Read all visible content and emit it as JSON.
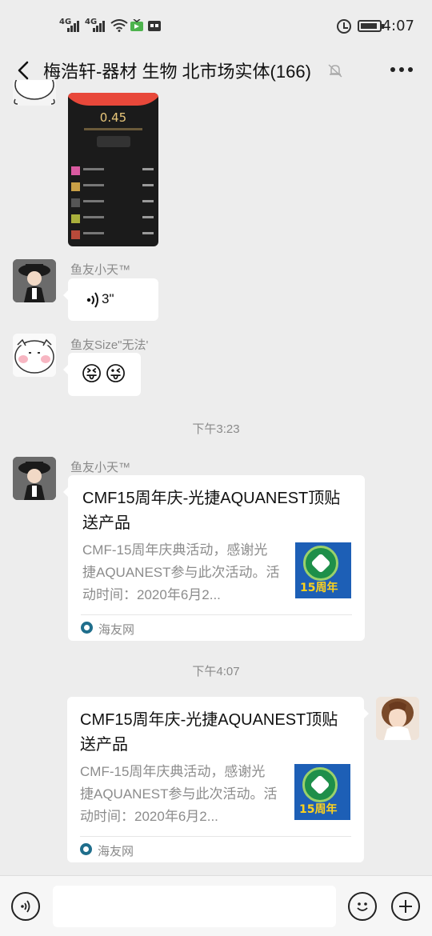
{
  "status_bar": {
    "network_1": "4G",
    "network_2": "4G",
    "time": "4:07",
    "icons": [
      "signal-icon",
      "signal-icon",
      "wifi-icon",
      "tv-app-icon",
      "app-notification-icon",
      "alarm-icon",
      "battery-icon"
    ],
    "battery_level": 0.75
  },
  "header": {
    "title": "梅浩轩-器材 生物 北市场实体(166)",
    "back_icon": "chevron-left-icon",
    "mute_icon": "bell-muted-icon",
    "more_icon": "more-dots-icon"
  },
  "messages": [
    {
      "type": "image",
      "amount": "0.45"
    },
    {
      "type": "voice",
      "sender": "鱼友小天™",
      "duration": "3\""
    },
    {
      "type": "emoji",
      "sender": "鱼友Size\"无法'",
      "emojis": [
        "😝",
        "😜"
      ]
    },
    {
      "type": "timestamp",
      "text": "下午3:23"
    },
    {
      "type": "link",
      "sender": "鱼友小天™",
      "title": "CMF15周年庆-光捷AQUANEST顶贴送产品",
      "description": "CMF-15周年庆典活动，感谢光捷AQUANEST参与此次活动。活动时间：2020年6月2...",
      "thumb_label": "15周年",
      "source": "海友网"
    },
    {
      "type": "timestamp",
      "text": "下午4:07"
    },
    {
      "type": "link",
      "direction": "outgoing",
      "title": "CMF15周年庆-光捷AQUANEST顶贴送产品",
      "description": "CMF-15周年庆典活动，感谢光捷AQUANEST参与此次活动。活动时间：2020年6月2...",
      "thumb_label": "15周年",
      "source": "海友网"
    }
  ],
  "input_bar": {
    "voice_icon": "voice-input-icon",
    "emoji_icon": "emoji-icon",
    "plus_icon": "plus-icon"
  },
  "colors": {
    "background": "#ededed",
    "bubble": "#ffffff",
    "meta_text": "#8a8a8a"
  }
}
